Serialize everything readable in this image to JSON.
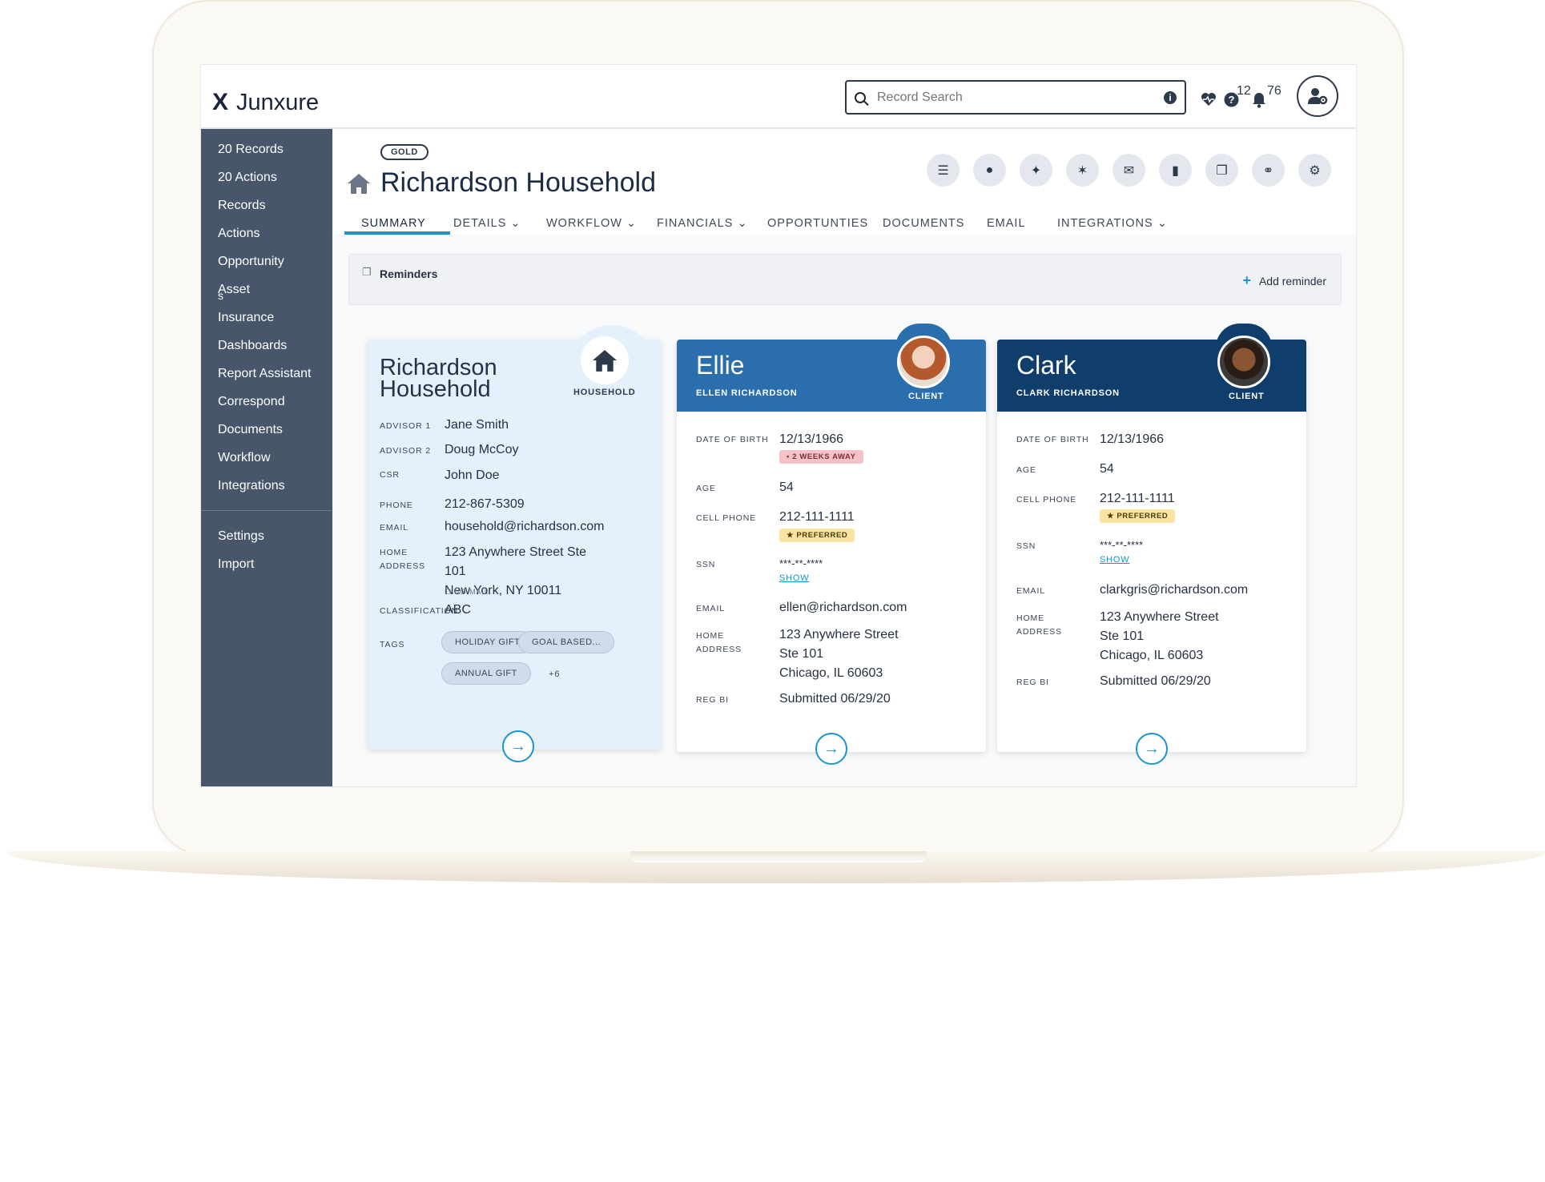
{
  "app": {
    "brand": "Junxure"
  },
  "topbar": {
    "search_placeholder": "Record Search",
    "help_count": "12",
    "notification_count": "76"
  },
  "sidebar": {
    "items": [
      "20 Records",
      "20 Actions",
      "Records",
      "Actions",
      "Opportunity",
      "Asset",
      "Insurance",
      "Dashboards",
      "Report Assistant",
      "Correspond",
      "Documents",
      "Workflow",
      "Integrations"
    ],
    "asset_overflow": "s",
    "bottom_items": [
      "Settings",
      "Import"
    ]
  },
  "record": {
    "tier": "GOLD",
    "title": "Richardson Household"
  },
  "tabs": [
    "SUMMARY",
    "DETAILS",
    "WORKFLOW",
    "FINANCIALS",
    "OPPORTUNTIES",
    "DOCUMENTS",
    "EMAIL",
    "INTEGRATIONS"
  ],
  "reminders": {
    "label": "Reminders",
    "add_label": "Add reminder"
  },
  "household": {
    "name_line1": "Richardson",
    "name_line2": "Household",
    "badge": "HOUSEHOLD",
    "advisor1_label": "ADVISOR 1",
    "advisor1": "Jane Smith",
    "advisor2_label": "ADVISOR 2",
    "advisor2": "Doug McCoy",
    "csr_label": "CSR",
    "csr": "John Doe",
    "phone_label": "PHONE",
    "phone": "212-867-5309",
    "email_label": "EMAIL",
    "email": "household@richardson.com",
    "address_label1": "HOME",
    "address_label2": "ADDRESS",
    "address1": "123 Anywhere Street Ste",
    "address2": "101",
    "address3": "New York, NY 10011",
    "no_mail": "NO MAIL",
    "classification_label": "CLASSIFICATION",
    "classification": "ABC",
    "tags_label": "TAGS",
    "tags": [
      "HOLIDAY GIFT",
      "GOAL BASED...",
      "ANNUAL GIFT"
    ],
    "more_tags": "+6"
  },
  "ellie": {
    "first": "Ellie",
    "full": "ELLEN RICHARDSON",
    "role": "CLIENT",
    "dob_label": "DATE OF BIRTH",
    "dob": "12/13/1966",
    "dob_pill": "2 WEEKS AWAY",
    "age_label": "AGE",
    "age": "54",
    "cell_label": "CELL PHONE",
    "cell": "212-111-1111",
    "preferred": "PREFERRED",
    "ssn_label": "SSN",
    "ssn": "***-**-****",
    "show": "SHOW",
    "email_label": "EMAIL",
    "email": "ellen@richardson.com",
    "address_label1": "HOME",
    "address_label2": "ADDRESS",
    "address1": "123 Anywhere Street",
    "address2": "Ste 101",
    "address3": "Chicago, IL 60603",
    "regbi_label": "REG BI",
    "regbi": "Submitted 06/29/20"
  },
  "clark": {
    "first": "Clark",
    "full": "CLARK RICHARDSON",
    "role": "CLIENT",
    "dob_label": "DATE OF BIRTH",
    "dob": "12/13/1966",
    "age_label": "AGE",
    "age": "54",
    "cell_label": "CELL PHONE",
    "cell": "212-111-1111",
    "preferred": "PREFERRED",
    "ssn_label": "SSN",
    "ssn": "***-**-****",
    "show": "SHOW",
    "email_label": "EMAIL",
    "email": "clarkgris@richardson.com",
    "address_label1": "HOME",
    "address_label2": "ADDRESS",
    "address1": "123 Anywhere Street",
    "address2": "Ste 101",
    "address3": "Chicago, IL 60603",
    "regbi_label": "REG BI",
    "regbi": "Submitted 06/29/20"
  },
  "colors": {
    "accent": "#1a94d2",
    "sidebar": "#47566a",
    "ellie_header": "#2b6ead",
    "clark_header": "#0f3d6c",
    "household_card": "#e4f1fc"
  }
}
